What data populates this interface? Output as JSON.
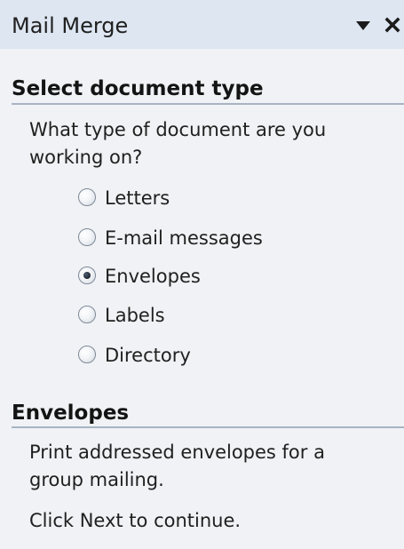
{
  "pane": {
    "title": "Mail Merge",
    "dropdown_icon": "triangle-down-icon",
    "close_icon": "close-icon"
  },
  "select_section": {
    "heading": "Select document type",
    "question_line1": "What type of document are you",
    "question_line2": "working on?",
    "options": [
      {
        "label": "Letters",
        "selected": false
      },
      {
        "label": "E-mail messages",
        "selected": false
      },
      {
        "label": "Envelopes",
        "selected": true
      },
      {
        "label": "Labels",
        "selected": false
      },
      {
        "label": "Directory",
        "selected": false
      }
    ]
  },
  "envelopes_section": {
    "heading": "Envelopes",
    "description_line1": "Print addressed envelopes for a",
    "description_line2": "group mailing.",
    "next_hint": "Click Next to continue."
  },
  "colors": {
    "title_bar": "#dde6f1",
    "pane_background": "#f0f2f5",
    "heading_rule": "#a8b4c2"
  }
}
